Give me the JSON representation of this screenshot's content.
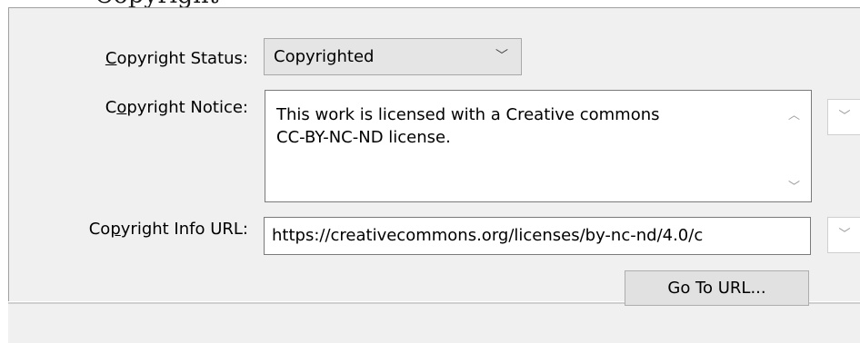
{
  "top_caption": "Copyright",
  "fields": {
    "status": {
      "label_prefix": "",
      "label_accel": "C",
      "label_suffix": "opyright Status:",
      "value": "Copyrighted",
      "chevron": "chevron-down-icon"
    },
    "notice": {
      "label_prefix": "C",
      "label_accel": "o",
      "label_suffix": "pyright Notice:",
      "value": "This work is licensed with a Creative commons\nCC-BY-NC-ND license."
    },
    "info_url": {
      "label_prefix": "Co",
      "label_accel": "p",
      "label_suffix": "yright Info URL:",
      "value": "https://creativecommons.org/licenses/by-nc-nd/4.0/c"
    }
  },
  "buttons": {
    "go_to_url": "Go To URL..."
  },
  "glyphs": {
    "chevron_down": "﹀",
    "chevron_up": "︿"
  }
}
